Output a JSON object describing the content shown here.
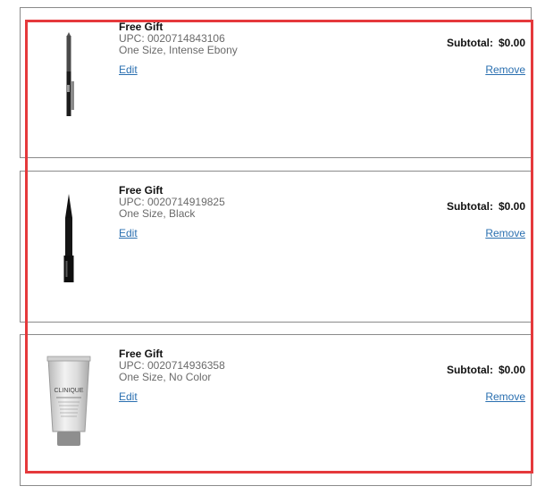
{
  "items": [
    {
      "title": "Free Gift",
      "upc": "UPC: 0020714843106",
      "variant": "One Size, Intense Ebony",
      "edit_label": "Edit",
      "subtotal_label": "Subtotal:",
      "subtotal_value": "$0.00",
      "remove_label": "Remove",
      "image_icon": "eyeliner-pencil-icon"
    },
    {
      "title": "Free Gift",
      "upc": "UPC: 0020714919825",
      "variant": "One Size, Black",
      "edit_label": "Edit",
      "subtotal_label": "Subtotal:",
      "subtotal_value": "$0.00",
      "remove_label": "Remove",
      "image_icon": "liquid-eyeliner-icon"
    },
    {
      "title": "Free Gift",
      "upc": "UPC: 0020714936358",
      "variant": "One Size, No Color",
      "edit_label": "Edit",
      "subtotal_label": "Subtotal:",
      "subtotal_value": "$0.00",
      "remove_label": "Remove",
      "image_icon": "serum-tube-icon"
    }
  ],
  "brand_on_tube": "CLINIQUE",
  "tube_text": "ultimate smart custom-repair serum concentré réparateur ciblé sur mesure",
  "colors": {
    "link": "#2a6fb0",
    "highlight": "#e5393c",
    "border": "#8a8a8a"
  }
}
